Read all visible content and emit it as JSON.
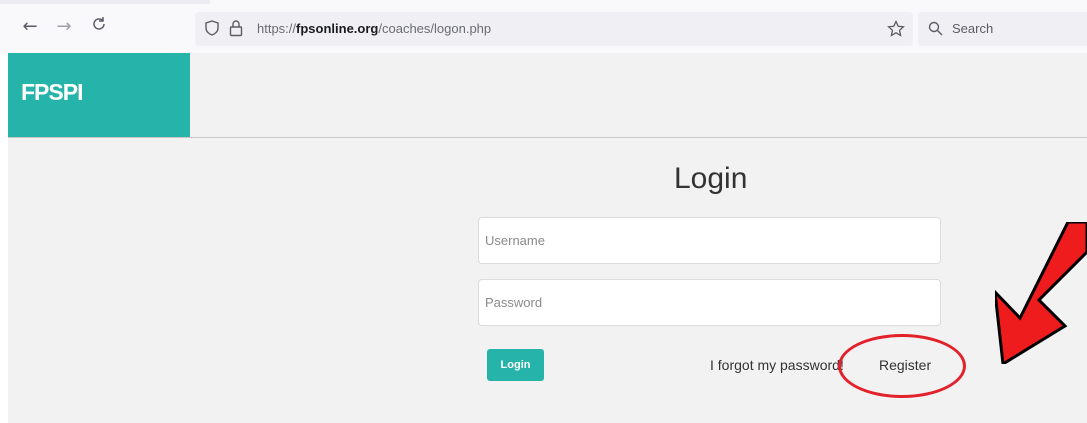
{
  "browser": {
    "back_icon": "arrow-left-icon",
    "forward_icon": "arrow-right-icon",
    "reload_icon": "reload-icon",
    "url_prefix": "https://",
    "url_domain": "fpsonline.org",
    "url_path": "/coaches/logon.php",
    "search_label": "Search"
  },
  "site": {
    "brand": "FPSPI",
    "brand_color": "#26b3a9"
  },
  "login": {
    "title": "Login",
    "username_placeholder": "Username",
    "password_placeholder": "Password",
    "login_button": "Login",
    "forgot_link": "I forgot my password!",
    "register_link": "Register"
  },
  "annotations": {
    "highlight_color": "#e3212b",
    "arrow_icon": "red-arrow-icon"
  }
}
